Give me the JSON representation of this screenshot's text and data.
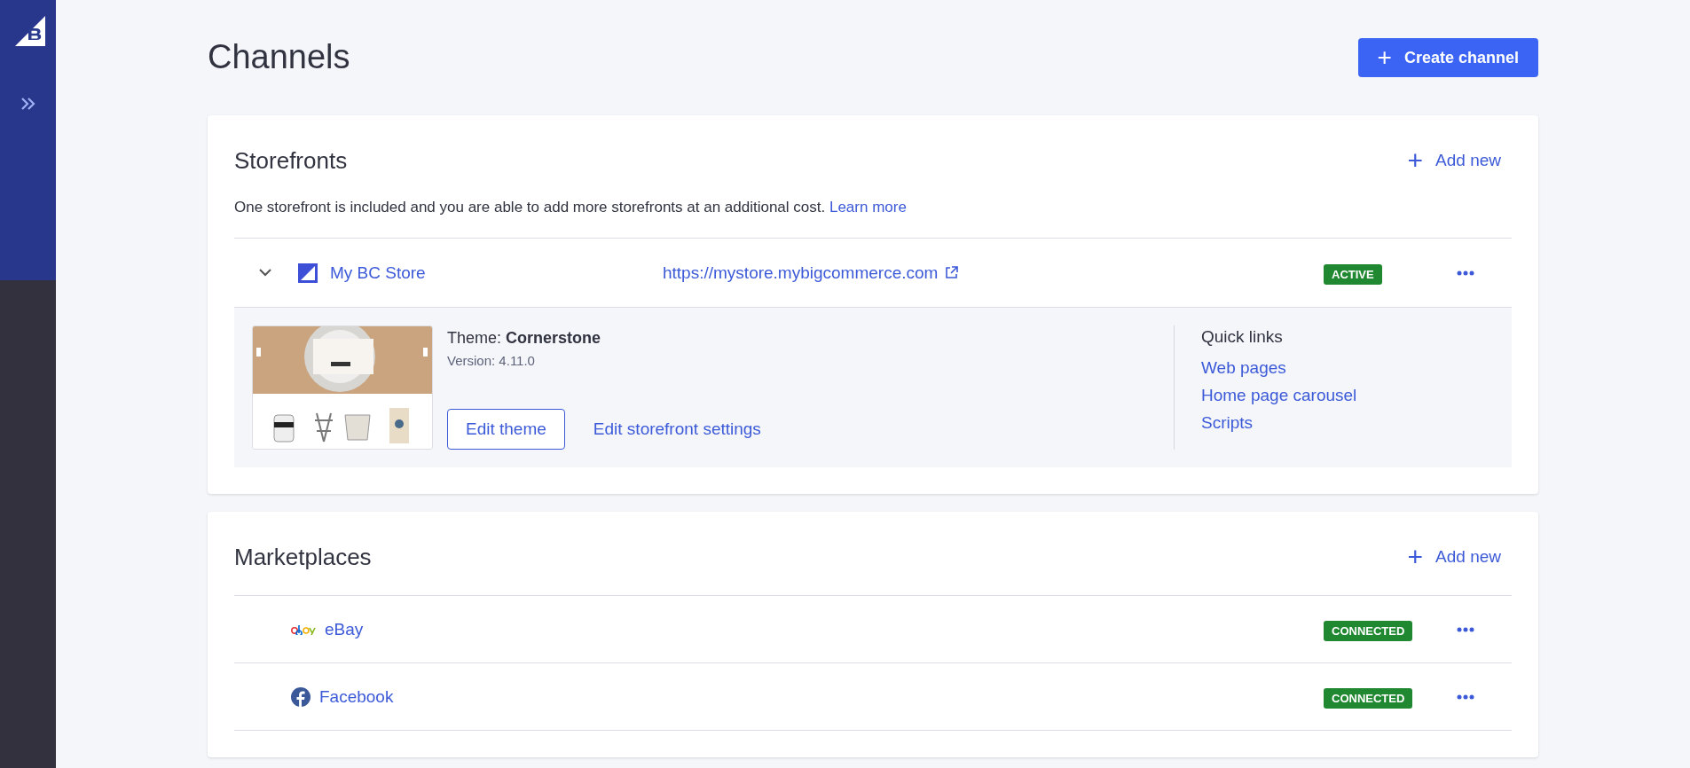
{
  "page": {
    "title": "Channels",
    "create_button": {
      "icon": "+",
      "label": "Create channel"
    }
  },
  "storefronts": {
    "title": "Storefronts",
    "add_new": {
      "icon": "+",
      "label": "Add new"
    },
    "description": "One storefront is included and you are able to add more storefronts at an additional cost.",
    "learn_more": "Learn more",
    "rows": [
      {
        "name": "My BC Store",
        "url": "https://mystore.mybigcommerce.com",
        "status": "ACTIVE",
        "expanded": true,
        "theme": {
          "label": "Theme:",
          "name": "Cornerstone",
          "version": "Version: 4.11.0",
          "edit_theme": "Edit theme",
          "edit_settings": "Edit storefront settings"
        },
        "quick_links": {
          "title": "Quick links",
          "links": [
            "Web pages",
            "Home page carousel",
            "Scripts"
          ]
        }
      }
    ]
  },
  "marketplaces": {
    "title": "Marketplaces",
    "add_new": {
      "icon": "+",
      "label": "Add new"
    },
    "rows": [
      {
        "kind": "ebay",
        "name": "eBay",
        "status": "CONNECTED"
      },
      {
        "kind": "facebook",
        "name": "Facebook",
        "status": "CONNECTED"
      }
    ]
  }
}
